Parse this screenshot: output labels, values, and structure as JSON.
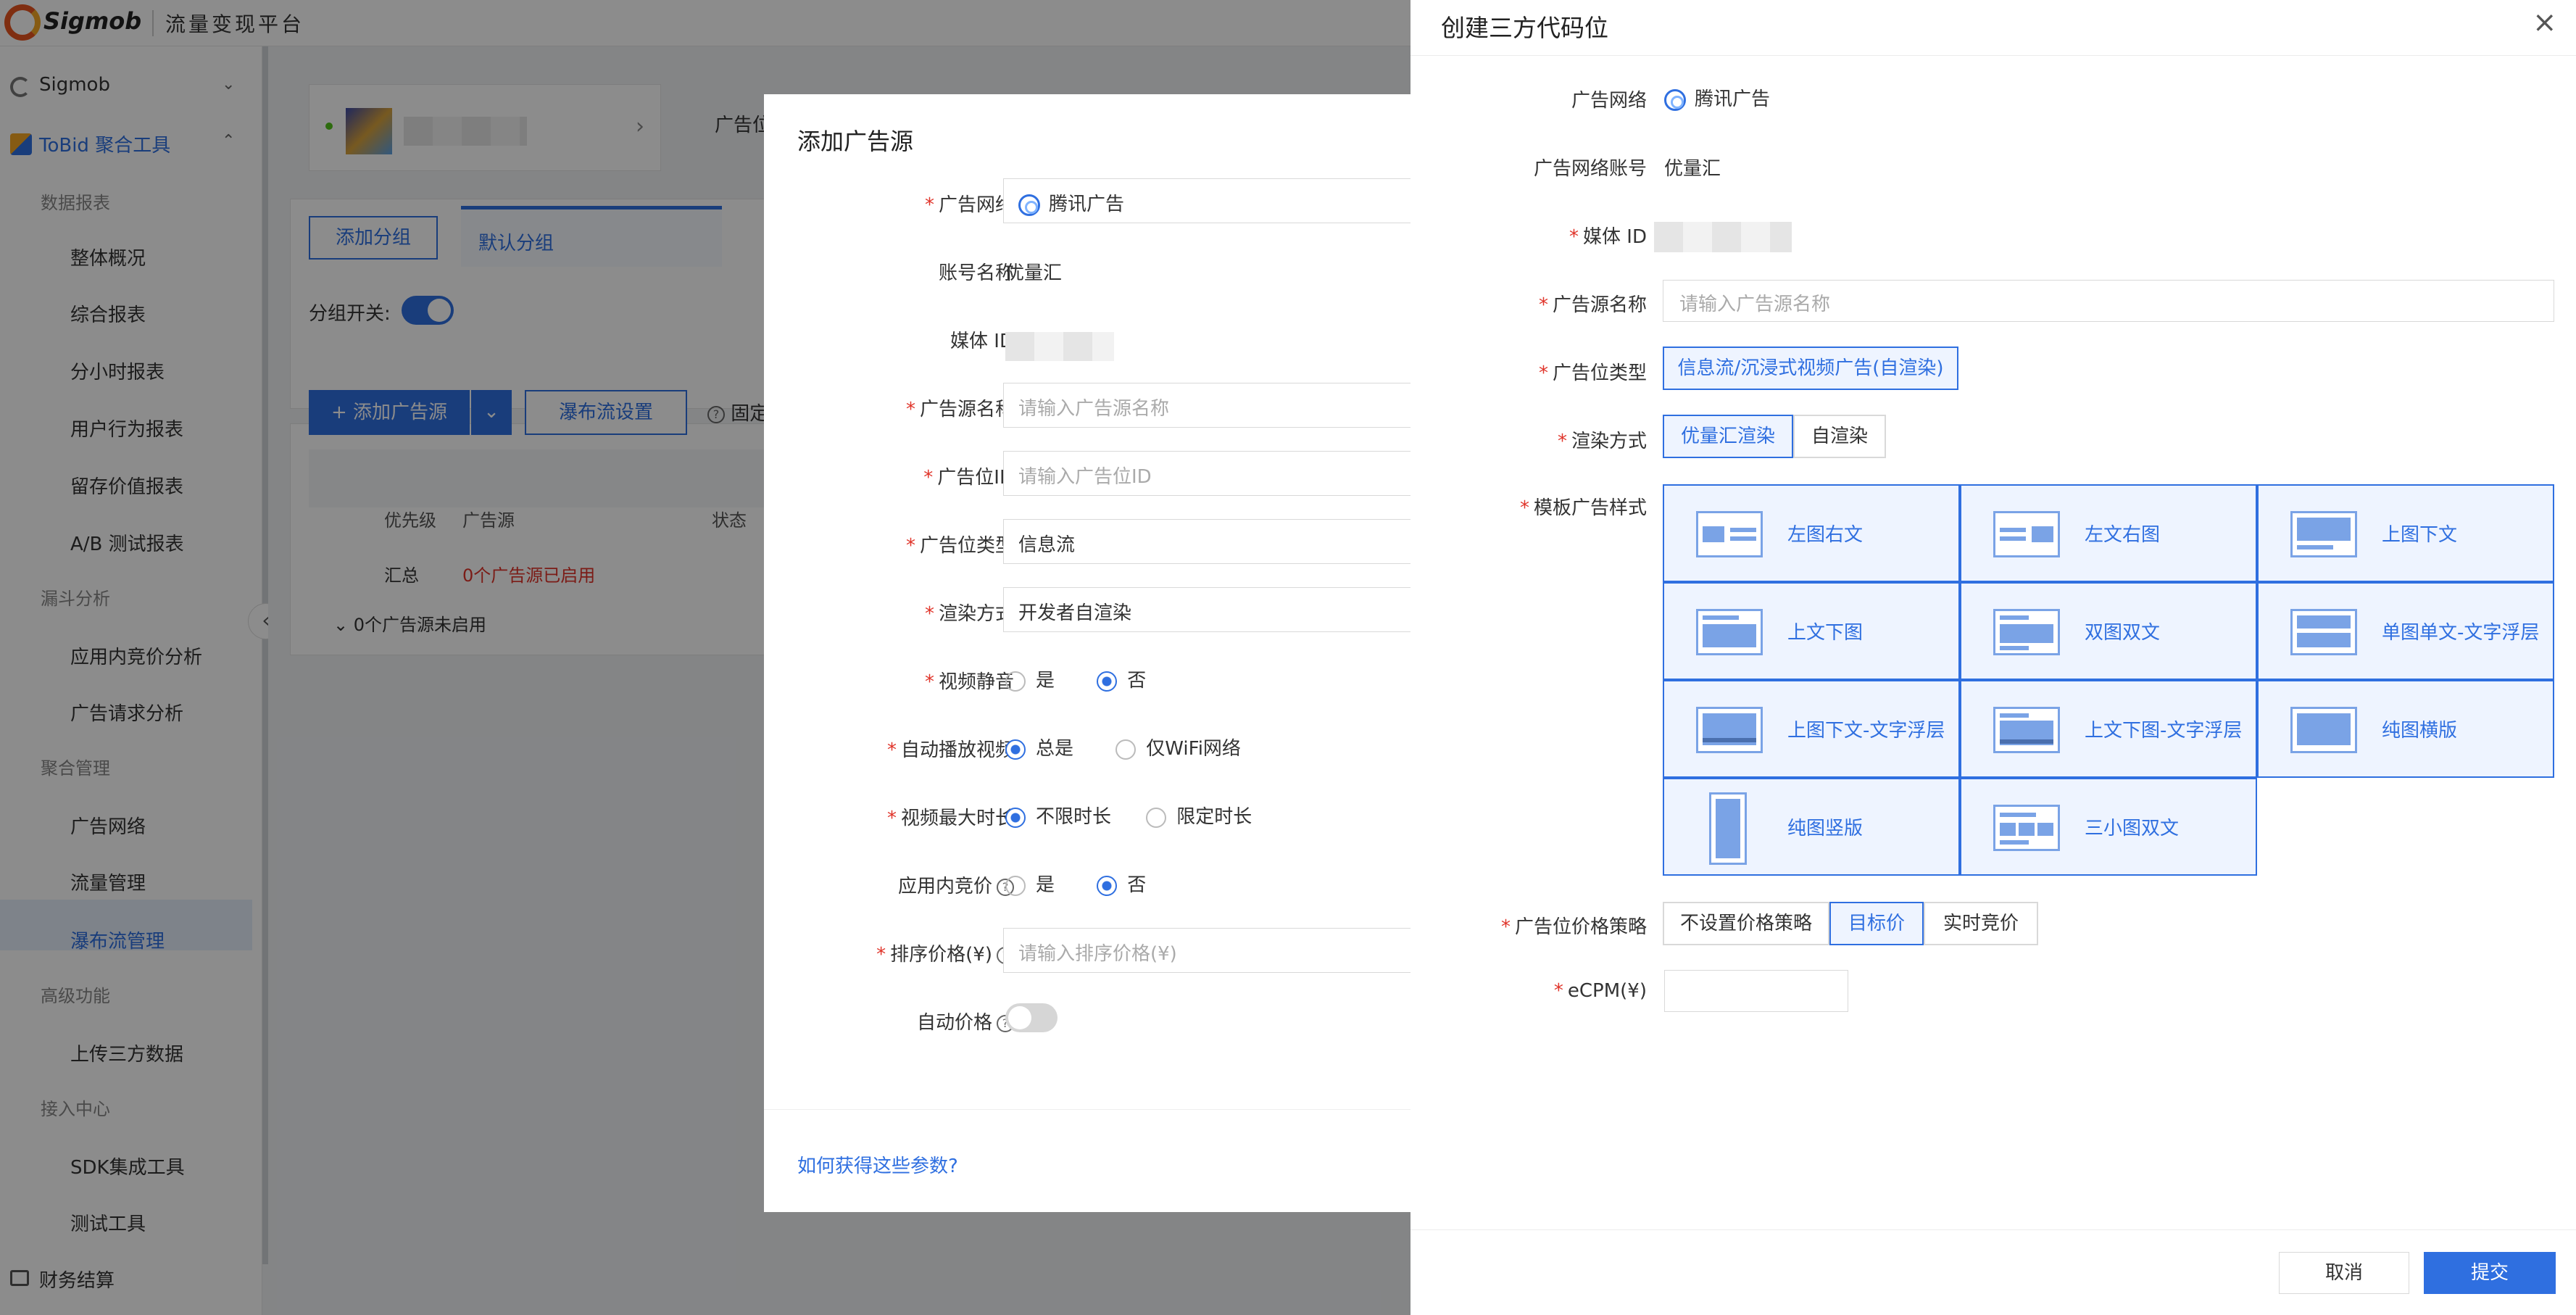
{
  "topbar": {
    "brand": "Sigmob",
    "platform": "流量变现平台"
  },
  "sidebar": {
    "account": "Sigmob",
    "tool": "ToBid 聚合工具",
    "groups": [
      {
        "title": "数据报表",
        "items": [
          "整体概况",
          "综合报表",
          "分小时报表",
          "用户行为报表",
          "留存价值报表",
          "A/B 测试报表"
        ]
      },
      {
        "title": "漏斗分析",
        "items": [
          "应用内竞价分析",
          "广告请求分析"
        ]
      },
      {
        "title": "聚合管理",
        "items": [
          "广告网络",
          "流量管理",
          "瀑布流管理"
        ]
      },
      {
        "title": "高级功能",
        "items": [
          "上传三方数据"
        ]
      },
      {
        "title": "接入中心",
        "items": [
          "SDK集成工具",
          "测试工具"
        ]
      }
    ],
    "finance": "财务结算"
  },
  "main": {
    "ad_pos_prefix": "广告位",
    "add_group": "添加分组",
    "default_group": "默认分组",
    "group_switch": "分组开关:",
    "add_source": "添加广告源",
    "waterfall_settings": "瀑布流设置",
    "fixed": "固定",
    "col_priority": "优先级",
    "col_source": "广告源",
    "col_status": "状态",
    "summary": "汇总",
    "summary_value": "0个广告源已启用",
    "disabled_count": "0个广告源未启用"
  },
  "modal": {
    "title": "添加广告源",
    "fields": {
      "network_label": "广告网络",
      "network_value": "腾讯广告",
      "account_label": "账号名称",
      "account_value": "优量汇",
      "media_label": "媒体 ID",
      "source_name_label": "广告源名称",
      "source_name_ph": "请输入广告源名称",
      "pos_id_label": "广告位ID",
      "pos_id_ph": "请输入广告位ID",
      "pos_type_label": "广告位类型",
      "pos_type_value": "信息流",
      "render_label": "渲染方式",
      "render_value": "开发者自渲染",
      "mute_label": "视频静音",
      "mute_yes": "是",
      "mute_no": "否",
      "autoplay_label": "自动播放视频",
      "autoplay_always": "总是",
      "autoplay_wifi": "仅WiFi网络",
      "maxlen_label": "视频最大时长",
      "maxlen_unlimited": "不限时长",
      "maxlen_limited": "限定时长",
      "bidding_label": "应用内竞价",
      "bidding_yes": "是",
      "bidding_no": "否",
      "sort_price_label": "排序价格(¥)",
      "sort_price_ph": "请输入排序价格(¥)",
      "auto_price_label": "自动价格"
    },
    "help_link": "如何获得这些参数?"
  },
  "drawer": {
    "title": "创建三方代码位",
    "network_label": "广告网络",
    "network_value": "腾讯广告",
    "account_label": "广告网络账号",
    "account_value": "优量汇",
    "media_label": "媒体 ID",
    "source_name_label": "广告源名称",
    "source_name_ph": "请输入广告源名称",
    "pos_type_label": "广告位类型",
    "pos_type_value": "信息流/沉浸式视频广告(自渲染)",
    "render_label": "渲染方式",
    "render_opt1": "优量汇渲染",
    "render_opt2": "自渲染",
    "template_label": "模板广告样式",
    "templates": [
      "左图右文",
      "左文右图",
      "上图下文",
      "上文下图",
      "双图双文",
      "单图单文-文字浮层",
      "上图下文-文字浮层",
      "上文下图-文字浮层",
      "纯图横版",
      "纯图竖版",
      "三小图双文"
    ],
    "price_label": "广告位价格策略",
    "price_opt1": "不设置价格策略",
    "price_opt2": "目标价",
    "price_opt3": "实时竞价",
    "ecpm_label": "eCPM(¥)",
    "cancel": "取消",
    "submit": "提交"
  },
  "colors": {
    "accent": "#2f6fe0",
    "required": "#e0342a",
    "selected_bg": "#eef4ff"
  }
}
